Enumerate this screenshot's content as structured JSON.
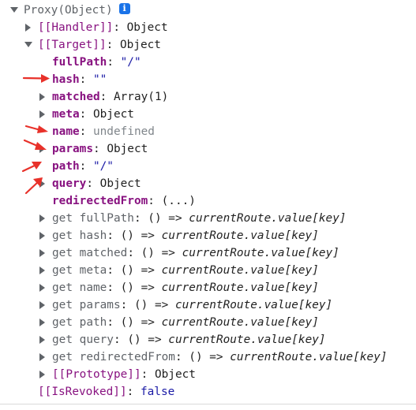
{
  "root": {
    "label": "Proxy(Object)",
    "info_badge": "i"
  },
  "handler": {
    "key": "[[Handler]]",
    "sep": ": ",
    "value": "Object"
  },
  "target": {
    "key": "[[Target]]",
    "sep": ": ",
    "value": "Object",
    "props": [
      {
        "key": "fullPath",
        "sep": ": ",
        "value": "\"/\"",
        "kind": "string",
        "expandable": false
      },
      {
        "key": "hash",
        "sep": ": ",
        "value": "\"\"",
        "kind": "string",
        "expandable": false
      },
      {
        "key": "matched",
        "sep": ": ",
        "value": "Array(1)",
        "kind": "object",
        "expandable": true
      },
      {
        "key": "meta",
        "sep": ": ",
        "value": "Object",
        "kind": "object",
        "expandable": true
      },
      {
        "key": "name",
        "sep": ": ",
        "value": "undefined",
        "kind": "undefined",
        "expandable": false
      },
      {
        "key": "params",
        "sep": ": ",
        "value": "Object",
        "kind": "object",
        "expandable": true
      },
      {
        "key": "path",
        "sep": ": ",
        "value": "\"/\"",
        "kind": "string",
        "expandable": false
      },
      {
        "key": "query",
        "sep": ": ",
        "value": "Object",
        "kind": "object",
        "expandable": true
      },
      {
        "key": "redirectedFrom",
        "sep": ": ",
        "value": "(...)",
        "kind": "lazy",
        "expandable": false
      }
    ],
    "getters": [
      {
        "key": "get fullPath",
        "sep": ": ",
        "fn_head": "() => ",
        "fn_body": "currentRoute.value[key]"
      },
      {
        "key": "get hash",
        "sep": ": ",
        "fn_head": "() => ",
        "fn_body": "currentRoute.value[key]"
      },
      {
        "key": "get matched",
        "sep": ": ",
        "fn_head": "() => ",
        "fn_body": "currentRoute.value[key]"
      },
      {
        "key": "get meta",
        "sep": ": ",
        "fn_head": "() => ",
        "fn_body": "currentRoute.value[key]"
      },
      {
        "key": "get name",
        "sep": ": ",
        "fn_head": "() => ",
        "fn_body": "currentRoute.value[key]"
      },
      {
        "key": "get params",
        "sep": ": ",
        "fn_head": "() => ",
        "fn_body": "currentRoute.value[key]"
      },
      {
        "key": "get path",
        "sep": ": ",
        "fn_head": "() => ",
        "fn_body": "currentRoute.value[key]"
      },
      {
        "key": "get query",
        "sep": ": ",
        "fn_head": "() => ",
        "fn_body": "currentRoute.value[key]"
      },
      {
        "key": "get redirectedFrom",
        "sep": ": ",
        "fn_head": "() => ",
        "fn_body": "currentRoute.value[key]"
      }
    ],
    "prototype": {
      "key": "[[Prototype]]",
      "sep": ": ",
      "value": "Object"
    }
  },
  "revoked": {
    "key": "[[IsRevoked]]",
    "sep": ": ",
    "value": "false"
  },
  "annotation": {
    "arrow_color": "#e8312a",
    "marked_props": [
      "hash",
      "name",
      "params",
      "path",
      "query"
    ]
  }
}
